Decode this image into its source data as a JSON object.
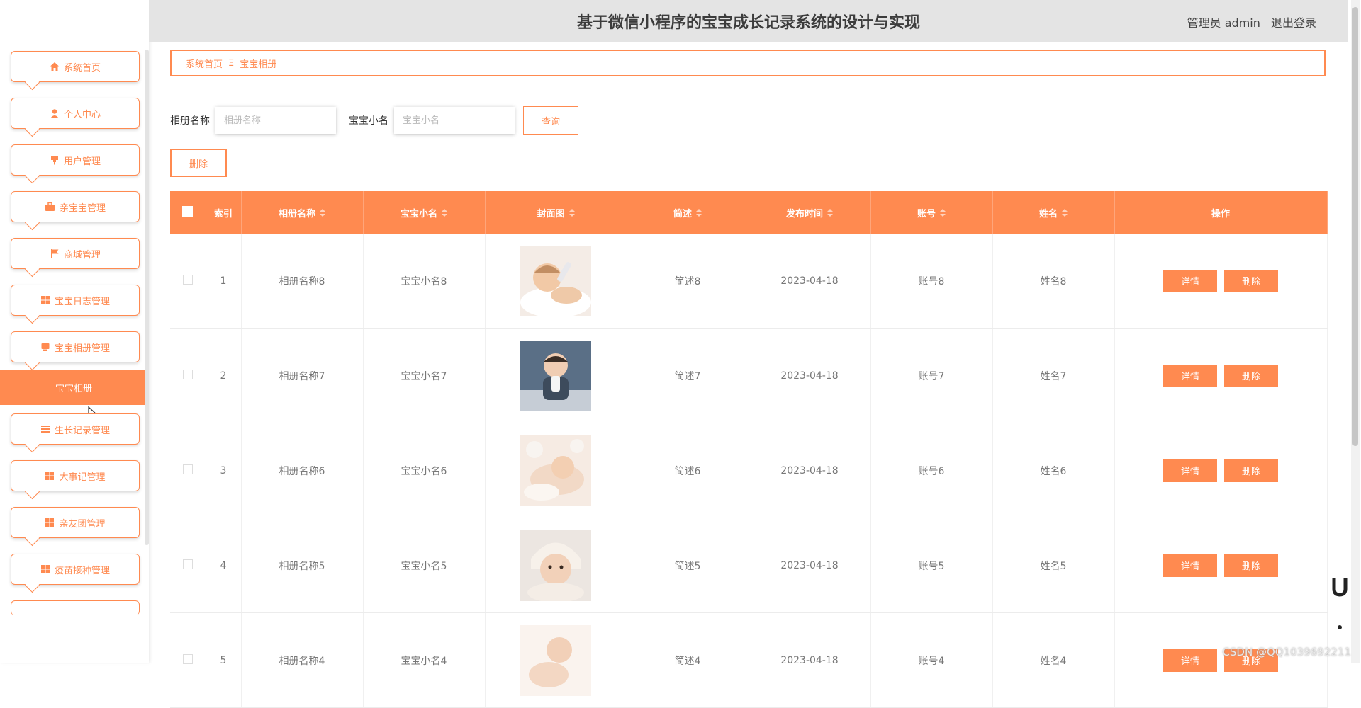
{
  "header": {
    "title": "基于微信小程序的宝宝成长记录系统的设计与实现",
    "user_label": "管理员 admin",
    "logout_label": "退出登录"
  },
  "sidebar": {
    "items": [
      {
        "label": "系统首页",
        "icon": "home-icon"
      },
      {
        "label": "个人中心",
        "icon": "user-icon"
      },
      {
        "label": "用户管理",
        "icon": "flag-pin-icon"
      },
      {
        "label": "亲宝宝管理",
        "icon": "briefcase-icon"
      },
      {
        "label": "商城管理",
        "icon": "flag-icon"
      },
      {
        "label": "宝宝日志管理",
        "icon": "grid-icon"
      },
      {
        "label": "宝宝相册管理",
        "icon": "album-icon"
      }
    ],
    "active_sub": "宝宝相册",
    "items_after": [
      {
        "label": "生长记录管理",
        "icon": "list-icon"
      },
      {
        "label": "大事记管理",
        "icon": "grid-icon"
      },
      {
        "label": "亲友团管理",
        "icon": "grid-icon"
      },
      {
        "label": "疫苗接种管理",
        "icon": "grid-icon"
      }
    ]
  },
  "breadcrumb": {
    "home": "系统首页",
    "separator": "Ξ",
    "current": "宝宝相册"
  },
  "search": {
    "album_label": "相册名称",
    "album_placeholder": "相册名称",
    "baby_label": "宝宝小名",
    "baby_placeholder": "宝宝小名",
    "query_button": "查询",
    "delete_button": "删除"
  },
  "table": {
    "columns": [
      "索引",
      "相册名称",
      "宝宝小名",
      "封面图",
      "简述",
      "发布时间",
      "账号",
      "姓名",
      "操作"
    ],
    "rows": [
      {
        "index": "1",
        "album": "相册名称8",
        "baby": "宝宝小名8",
        "summary": "简述8",
        "date": "2023-04-18",
        "account": "账号8",
        "name": "姓名8"
      },
      {
        "index": "2",
        "album": "相册名称7",
        "baby": "宝宝小名7",
        "summary": "简述7",
        "date": "2023-04-18",
        "account": "账号7",
        "name": "姓名7"
      },
      {
        "index": "3",
        "album": "相册名称6",
        "baby": "宝宝小名6",
        "summary": "简述6",
        "date": "2023-04-18",
        "account": "账号6",
        "name": "姓名6"
      },
      {
        "index": "4",
        "album": "相册名称5",
        "baby": "宝宝小名5",
        "summary": "简述5",
        "date": "2023-04-18",
        "account": "账号5",
        "name": "姓名5"
      },
      {
        "index": "5",
        "album": "相册名称4",
        "baby": "宝宝小名4",
        "summary": "简述4",
        "date": "2023-04-18",
        "account": "账号4",
        "name": "姓名4"
      }
    ],
    "detail_button": "详情",
    "delete_button": "删除"
  },
  "watermark": "CSDN @QQ1039692211",
  "colors": {
    "accent": "#ff8a50",
    "header_bg": "#e4e4e4"
  }
}
